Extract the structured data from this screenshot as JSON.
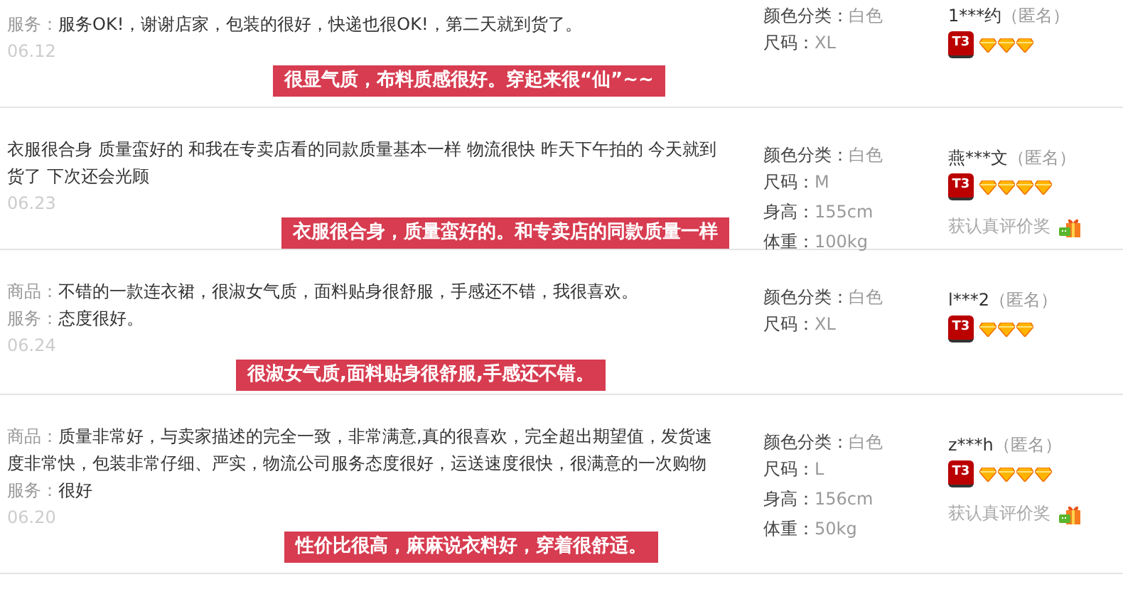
{
  "reviews": [
    {
      "lines": [
        {
          "label": "服务：",
          "text": "服务OK!，谢谢店家，包装的很好，快递也很OK!，第二天就到货了。"
        }
      ],
      "date": "06.12",
      "tag": "很显气质，布料质感很好。穿起来很“仙”~~",
      "props": [
        {
          "label": "颜色分类：",
          "value": "白色"
        },
        {
          "label": "尺码：",
          "value": "XL"
        }
      ],
      "user": "1***约",
      "anon": "（匿名）",
      "badge": "T3",
      "stars": 3
    },
    {
      "lines": [
        {
          "text": "衣服很合身 质量蛮好的 和我在专卖店看的同款质量基本一样 物流很快 昨天下午拍的 今天就到货了 下次还会光顾"
        }
      ],
      "date": "06.23",
      "tag": "衣服很合身，质量蛮好的。和专卖店的同款质量一样",
      "props": [
        {
          "label": "颜色分类：",
          "value": "白色"
        },
        {
          "label": "尺码：",
          "value": "M"
        },
        {
          "label": "身高：",
          "value": "155cm"
        },
        {
          "label": "体重：",
          "value": "100kg"
        }
      ],
      "user": "燕***文",
      "anon": "（匿名）",
      "badge": "T3",
      "stars": 4,
      "reward": "获认真评价奖"
    },
    {
      "lines": [
        {
          "label": "商品：",
          "text": "不错的一款连衣裙，很淑女气质，面料贴身很舒服，手感还不错，我很喜欢。"
        },
        {
          "label": "服务：",
          "text": "态度很好。"
        }
      ],
      "date": "06.24",
      "tag": "很淑女气质,面料贴身很舒服,手感还不错。",
      "props": [
        {
          "label": "颜色分类：",
          "value": "白色"
        },
        {
          "label": "尺码：",
          "value": "XL"
        }
      ],
      "user": "l***2",
      "anon": "（匿名）",
      "badge": "T3",
      "stars": 3
    },
    {
      "lines": [
        {
          "label": "商品：",
          "text": "质量非常好，与卖家描述的完全一致，非常满意,真的很喜欢，完全超出期望值，发货速度非常快，包装非常仔细、严实，物流公司服务态度很好，运送速度很快，很满意的一次购物"
        },
        {
          "label": "服务：",
          "text": "很好"
        }
      ],
      "date": "06.20",
      "tag": "性价比很高，麻麻说衣料好，穿着很舒适。",
      "props": [
        {
          "label": "颜色分类：",
          "value": "白色"
        },
        {
          "label": "尺码：",
          "value": "L"
        },
        {
          "label": "身高：",
          "value": "156cm"
        },
        {
          "label": "体重：",
          "value": "50kg"
        }
      ],
      "user": "z***h",
      "anon": "（匿名）",
      "badge": "T3",
      "stars": 4,
      "reward": "获认真评价奖"
    }
  ]
}
